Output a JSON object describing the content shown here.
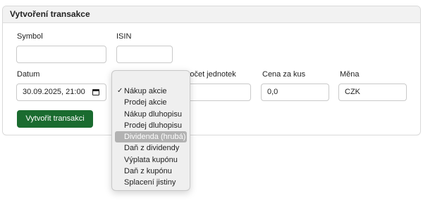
{
  "card": {
    "title": "Vytvoření transakce"
  },
  "form": {
    "symbol_label": "Symbol",
    "symbol_value": "",
    "isin_label": "ISIN",
    "isin_value": "",
    "date_label": "Datum",
    "date_value": "30.09.2025, 21:00",
    "units_label": "Počet jednotek",
    "units_value": "",
    "price_label": "Cena za kus",
    "price_value": "0,0",
    "currency_label": "Měna",
    "currency_value": "CZK",
    "submit_label": "Vytvořit transakci"
  },
  "type_menu": {
    "selected": "Nákup akcie",
    "highlighted": "Dividenda (hrubá)",
    "check_glyph": "✓",
    "items": [
      "Nákup akcie",
      "Prodej akcie",
      "Nákup dluhopisu",
      "Prodej dluhopisu",
      "Dividenda (hrubá)",
      "Daň z dividendy",
      "Výplata kupónu",
      "Daň z kupónu",
      "Splacení jistiny"
    ]
  },
  "colors": {
    "primary_button": "#1a6b2f",
    "highlight": "#b2b2b2"
  }
}
